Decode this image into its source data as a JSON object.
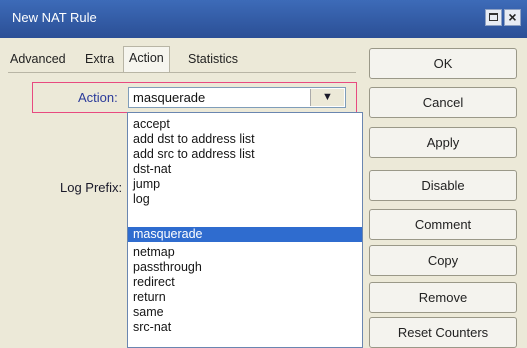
{
  "window": {
    "title": "New NAT Rule"
  },
  "tabs": [
    "Advanced",
    "Extra",
    "Action",
    "Statistics"
  ],
  "action": {
    "label": "Action:",
    "value": "masquerade",
    "selected": "masquerade"
  },
  "log_prefix": {
    "label": "Log Prefix:"
  },
  "dropdown": {
    "options": [
      "accept",
      "add dst to address list",
      "add src to address list",
      "dst-nat",
      "jump",
      "log",
      "masquerade",
      "netmap",
      "passthrough",
      "redirect",
      "return",
      "same",
      "src-nat"
    ]
  },
  "buttons": [
    "OK",
    "Cancel",
    "Apply",
    "Disable",
    "Comment",
    "Copy",
    "Remove",
    "Reset Counters"
  ],
  "colors": {
    "titlebar": "#2b4f96",
    "selection": "#2f6ccf",
    "highlight_box": "#e84a80"
  }
}
